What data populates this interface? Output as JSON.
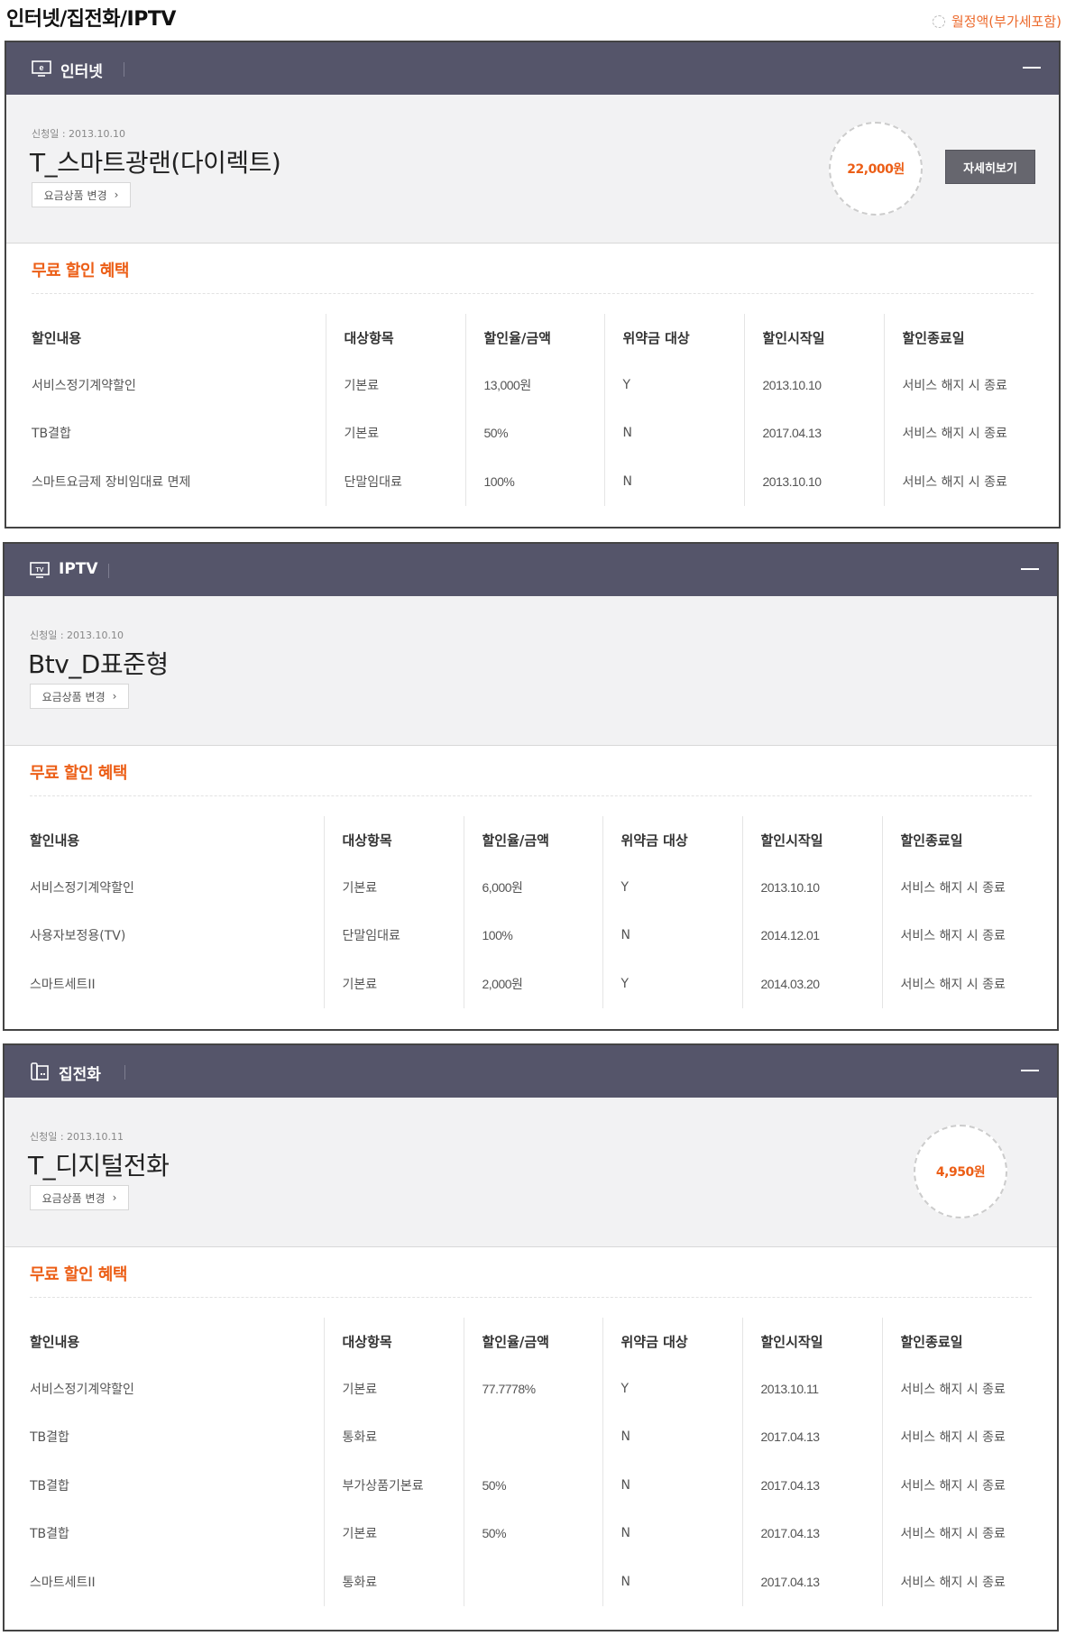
{
  "page": {
    "title": "인터넷/집전화/IPTV",
    "monthly_note": "월정액(부가세포함)"
  },
  "internet": {
    "section_title": "인터넷",
    "apply_date": "신청일 : 2013.10.10",
    "plan_name": "T_스마트광랜(다이렉트)",
    "change_label": "요금상품 변경",
    "price": "22,000원",
    "detail_label": "자세히보기",
    "benefit_title": "무료 할인 혜택",
    "headers": [
      "할인내용",
      "대상항목",
      "할인율/금액",
      "위약금 대상",
      "할인시작일",
      "할인종료일"
    ],
    "rows": [
      [
        "서비스정기계약할인",
        "기본료",
        "13,000원",
        "Y",
        "2013.10.10",
        "서비스 해지 시 종료"
      ],
      [
        "TB결합",
        "기본료",
        "50%",
        "N",
        "2017.04.13",
        "서비스 해지 시 종료"
      ],
      [
        "스마트요금제 장비임대료 면제",
        "단말임대료",
        "100%",
        "N",
        "2013.10.10",
        "서비스 해지 시 종료"
      ]
    ]
  },
  "iptv": {
    "section_title": "IPTV",
    "apply_date": "신청일 : 2013.10.10",
    "plan_name": "Btv_D표준형",
    "change_label": "요금상품 변경",
    "benefit_title": "무료 할인 혜택",
    "headers": [
      "할인내용",
      "대상항목",
      "할인율/금액",
      "위약금 대상",
      "할인시작일",
      "할인종료일"
    ],
    "rows": [
      [
        "서비스정기계약할인",
        "기본료",
        "6,000원",
        "Y",
        "2013.10.10",
        "서비스 해지 시 종료"
      ],
      [
        "사용자보정용(TV)",
        "단말임대료",
        "100%",
        "N",
        "2014.12.01",
        "서비스 해지 시 종료"
      ],
      [
        "스마트세트II",
        "기본료",
        "2,000원",
        "Y",
        "2014.03.20",
        "서비스 해지 시 종료"
      ]
    ]
  },
  "phone": {
    "section_title": "집전화",
    "apply_date": "신청일 : 2013.10.11",
    "plan_name": "T_디지털전화",
    "change_label": "요금상품 변경",
    "price": "4,950원",
    "benefit_title": "무료 할인 혜택",
    "headers": [
      "할인내용",
      "대상항목",
      "할인율/금액",
      "위약금 대상",
      "할인시작일",
      "할인종료일"
    ],
    "rows": [
      [
        "서비스정기계약할인",
        "기본료",
        "77.7778%",
        "Y",
        "2013.10.11",
        "서비스 해지 시 종료"
      ],
      [
        "TB결합",
        "통화료",
        "",
        "N",
        "2017.04.13",
        "서비스 해지 시 종료"
      ],
      [
        "TB결합",
        "부가상품기본료",
        "50%",
        "N",
        "2017.04.13",
        "서비스 해지 시 종료"
      ],
      [
        "TB결합",
        "기본료",
        "50%",
        "N",
        "2017.04.13",
        "서비스 해지 시 종료"
      ],
      [
        "스마트세트II",
        "통화료",
        "",
        "N",
        "2017.04.13",
        "서비스 해지 시 종료"
      ]
    ]
  }
}
